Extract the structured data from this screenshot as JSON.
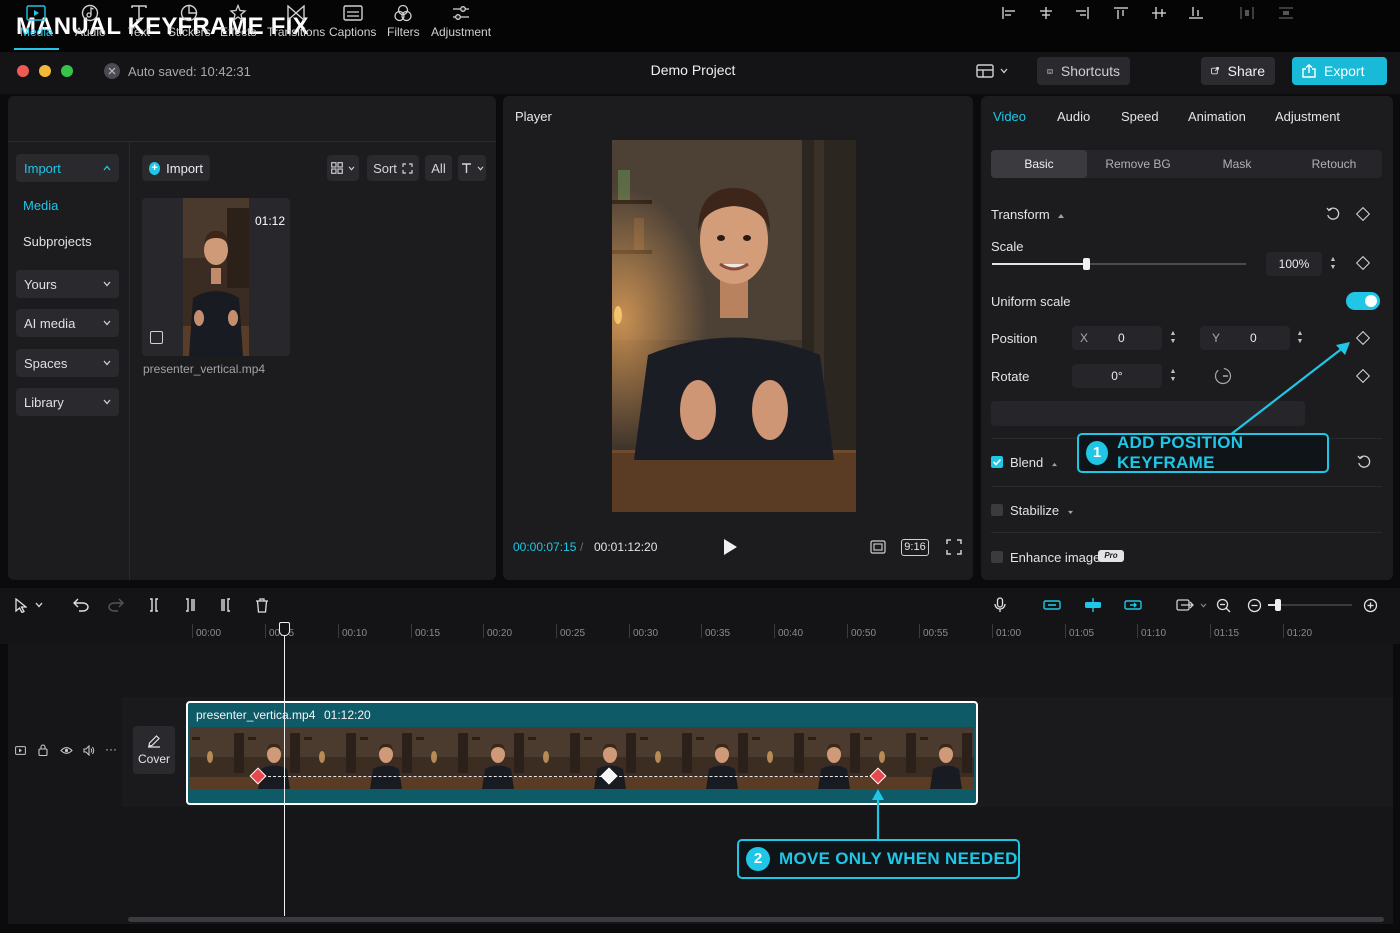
{
  "banner": {
    "title": "MANUAL KEYFRAME FIX"
  },
  "window": {
    "autosave": "Auto saved: 10:42:31",
    "project_title": "Demo Project",
    "shortcuts_label": "Shortcuts",
    "share_label": "Share",
    "export_label": "Export",
    "accent": "#1fc6e6"
  },
  "toolbar": {
    "tabs": [
      {
        "label": "Media",
        "icon": "media-icon"
      },
      {
        "label": "Audio",
        "icon": "audio-icon"
      },
      {
        "label": "Text",
        "icon": "text-icon"
      },
      {
        "label": "Stickers",
        "icon": "stickers-icon"
      },
      {
        "label": "Effects",
        "icon": "effects-icon"
      },
      {
        "label": "Transitions",
        "icon": "transitions-icon"
      },
      {
        "label": "Captions",
        "icon": "captions-icon"
      },
      {
        "label": "Filters",
        "icon": "filters-icon"
      },
      {
        "label": "Adjustment",
        "icon": "adjustment-icon"
      }
    ]
  },
  "sidebar": {
    "import_label": "Import",
    "media_label": "Media",
    "subprojects_label": "Subprojects",
    "groups": [
      "Yours",
      "AI media",
      "Spaces",
      "Library"
    ]
  },
  "media": {
    "import_label": "Import",
    "sort_label": "Sort",
    "filter_label": "All",
    "clip_duration": "01:12",
    "clip_name": "presenter_vertical.mp4"
  },
  "player": {
    "label": "Player",
    "current_time": "00:00:07:15",
    "separator": "/",
    "total_time": "00:01:12:20",
    "ratio": "9:16"
  },
  "properties": {
    "tabs": [
      "Video",
      "Audio",
      "Speed",
      "Animation",
      "Adjustment"
    ],
    "subtabs": [
      "Basic",
      "Remove BG",
      "Mask",
      "Retouch"
    ],
    "transform_label": "Transform",
    "scale_label": "Scale",
    "scale_value": "100%",
    "scale_level_pct": 37,
    "uniform_scale_label": "Uniform scale",
    "uniform_scale_on": true,
    "position_label": "Position",
    "x_label": "X",
    "x_value": "0",
    "y_label": "Y",
    "y_value": "0",
    "rotate_label": "Rotate",
    "rotate_value": "0°",
    "blend_label": "Blend",
    "blend_checked": true,
    "stabilize_label": "Stabilize",
    "enhance_label": "Enhance image",
    "pro_badge": "Pro"
  },
  "callouts": {
    "one_num": "1",
    "one_text": "ADD POSITION KEYFRAME",
    "two_num": "2",
    "two_text": "MOVE ONLY WHEN NEEDED"
  },
  "timeline": {
    "ticks": [
      "00:00",
      "00:05",
      "00:10",
      "00:15",
      "00:20",
      "00:25",
      "00:30",
      "00:35",
      "00:40",
      "00:50",
      "00:55",
      "01:00",
      "01:05",
      "01:10",
      "01:15",
      "01:20"
    ],
    "cover_label": "Cover",
    "clip_name": "presenter_vertica.mp4",
    "clip_duration": "01:12:20",
    "keyframes": [
      "red",
      "white",
      "red"
    ]
  }
}
